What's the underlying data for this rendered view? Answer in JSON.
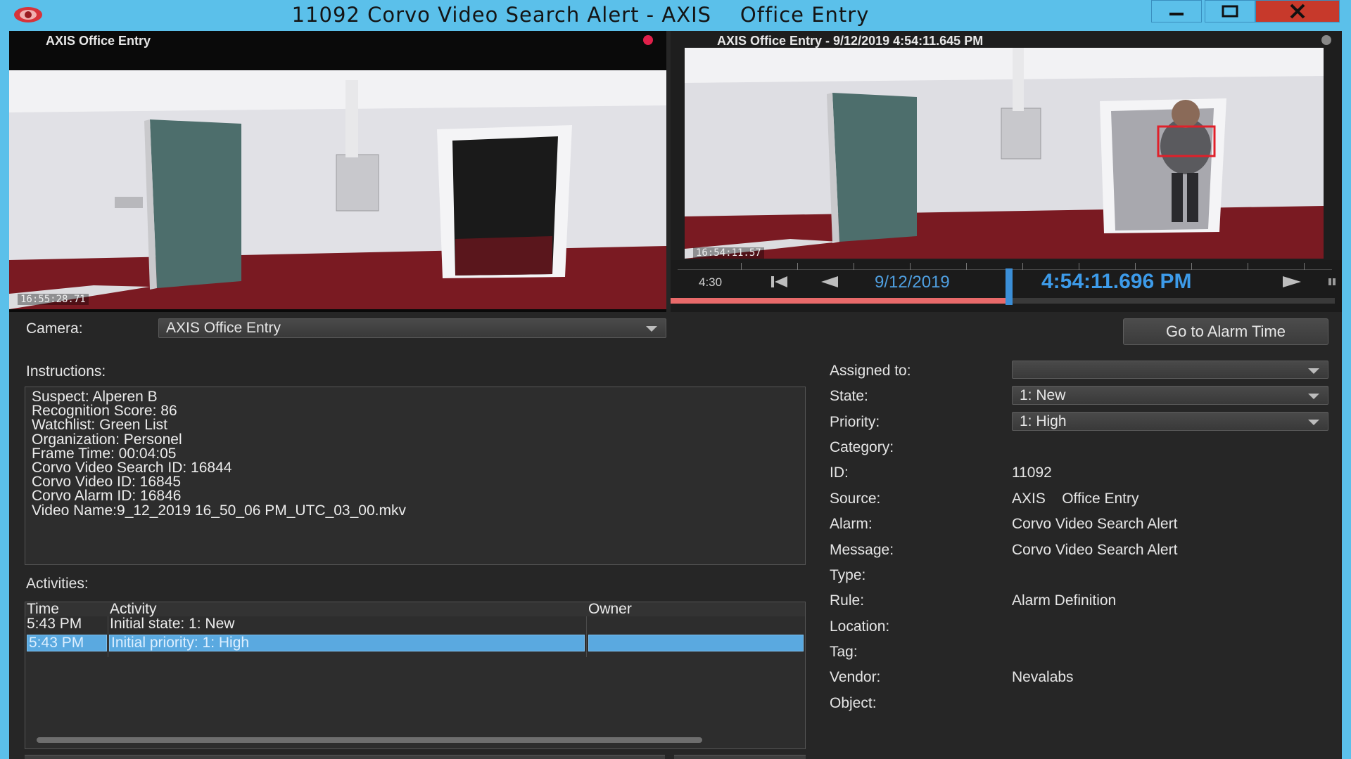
{
  "window": {
    "title": "11092 Corvo Video Search Alert - AXIS    Office Entry",
    "minimize_symbol": "—",
    "maximize_symbol": "☐",
    "close_symbol": "✕",
    "accent_color": "#5bc0ea",
    "close_color": "#c7392b"
  },
  "live": {
    "camera_label": "AXIS Office Entry",
    "osd_time": "16:55:28.71",
    "rec_color": "#e0204a"
  },
  "playback": {
    "camera_label": "AXIS Office Entry - 9/12/2019 4:54:11.645 PM",
    "osd_time": "16:54:11.57",
    "timeline_start": "4:30",
    "date": "9/12/2019",
    "time": "4:54:11.696 PM",
    "progress_fraction": 0.51,
    "timeline_color": "#3d9be9",
    "progress_color": "#e86a6a"
  },
  "camera": {
    "label": "Camera:",
    "selected": "AXIS Office Entry"
  },
  "goto_button": "Go to Alarm Time",
  "instructions": {
    "label": "Instructions:",
    "lines": [
      "Suspect: Alperen B",
      "Recognition Score: 86",
      "Watchlist: Green List",
      "Organization: Personel",
      "Frame Time: 00:04:05",
      "Corvo Video Search ID: 16844",
      "Corvo Video ID: 16845",
      "Corvo Alarm ID: 16846",
      "Video Name:9_12_2019 16_50_06 PM_UTC_03_00.mkv"
    ]
  },
  "activities": {
    "label": "Activities:",
    "columns": [
      "Time",
      "Activity",
      "Owner"
    ],
    "rows": [
      {
        "time": "5:43 PM",
        "activity": "Initial state: 1: New",
        "owner": ""
      },
      {
        "time": "5:43 PM",
        "activity": "Initial priority: 1: High",
        "owner": ""
      }
    ]
  },
  "details": {
    "assigned_to": {
      "label": "Assigned to:",
      "value": ""
    },
    "state": {
      "label": "State:",
      "value": "1: New"
    },
    "priority": {
      "label": "Priority:",
      "value": "1: High"
    },
    "category": {
      "label": "Category:",
      "value": ""
    },
    "id": {
      "label": "ID:",
      "value": "11092"
    },
    "source": {
      "label": "Source:",
      "value": "AXIS    Office Entry"
    },
    "alarm": {
      "label": "Alarm:",
      "value": "Corvo Video Search Alert"
    },
    "message": {
      "label": "Message:",
      "value": "Corvo Video Search Alert"
    },
    "type": {
      "label": "Type:",
      "value": ""
    },
    "rule": {
      "label": "Rule:",
      "value": "Alarm Definition"
    },
    "location": {
      "label": "Location:",
      "value": ""
    },
    "tag": {
      "label": "Tag:",
      "value": ""
    },
    "vendor": {
      "label": "Vendor:",
      "value": "Nevalabs"
    },
    "object": {
      "label": "Object:",
      "value": ""
    }
  },
  "icons": {
    "app": "eye-logo-icon",
    "skip_back": "skip-back-icon",
    "step_back": "step-back-icon",
    "play": "play-icon",
    "more": "more-icon",
    "dropdown": "chevron-down-icon"
  }
}
